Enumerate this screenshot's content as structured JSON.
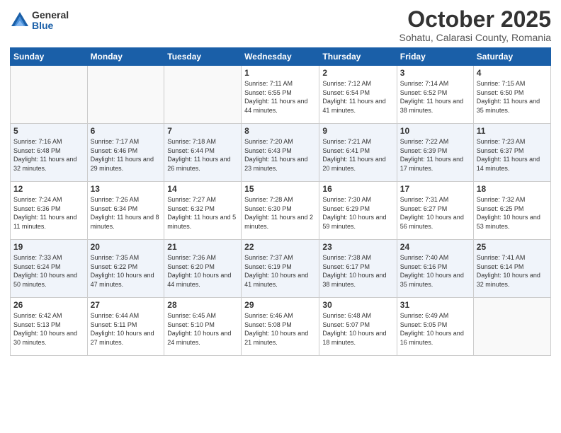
{
  "header": {
    "logo_general": "General",
    "logo_blue": "Blue",
    "month": "October 2025",
    "location": "Sohatu, Calarasi County, Romania"
  },
  "weekdays": [
    "Sunday",
    "Monday",
    "Tuesday",
    "Wednesday",
    "Thursday",
    "Friday",
    "Saturday"
  ],
  "weeks": [
    [
      {
        "day": "",
        "info": ""
      },
      {
        "day": "",
        "info": ""
      },
      {
        "day": "",
        "info": ""
      },
      {
        "day": "1",
        "info": "Sunrise: 7:11 AM\nSunset: 6:55 PM\nDaylight: 11 hours and 44 minutes."
      },
      {
        "day": "2",
        "info": "Sunrise: 7:12 AM\nSunset: 6:54 PM\nDaylight: 11 hours and 41 minutes."
      },
      {
        "day": "3",
        "info": "Sunrise: 7:14 AM\nSunset: 6:52 PM\nDaylight: 11 hours and 38 minutes."
      },
      {
        "day": "4",
        "info": "Sunrise: 7:15 AM\nSunset: 6:50 PM\nDaylight: 11 hours and 35 minutes."
      }
    ],
    [
      {
        "day": "5",
        "info": "Sunrise: 7:16 AM\nSunset: 6:48 PM\nDaylight: 11 hours and 32 minutes."
      },
      {
        "day": "6",
        "info": "Sunrise: 7:17 AM\nSunset: 6:46 PM\nDaylight: 11 hours and 29 minutes."
      },
      {
        "day": "7",
        "info": "Sunrise: 7:18 AM\nSunset: 6:44 PM\nDaylight: 11 hours and 26 minutes."
      },
      {
        "day": "8",
        "info": "Sunrise: 7:20 AM\nSunset: 6:43 PM\nDaylight: 11 hours and 23 minutes."
      },
      {
        "day": "9",
        "info": "Sunrise: 7:21 AM\nSunset: 6:41 PM\nDaylight: 11 hours and 20 minutes."
      },
      {
        "day": "10",
        "info": "Sunrise: 7:22 AM\nSunset: 6:39 PM\nDaylight: 11 hours and 17 minutes."
      },
      {
        "day": "11",
        "info": "Sunrise: 7:23 AM\nSunset: 6:37 PM\nDaylight: 11 hours and 14 minutes."
      }
    ],
    [
      {
        "day": "12",
        "info": "Sunrise: 7:24 AM\nSunset: 6:36 PM\nDaylight: 11 hours and 11 minutes."
      },
      {
        "day": "13",
        "info": "Sunrise: 7:26 AM\nSunset: 6:34 PM\nDaylight: 11 hours and 8 minutes."
      },
      {
        "day": "14",
        "info": "Sunrise: 7:27 AM\nSunset: 6:32 PM\nDaylight: 11 hours and 5 minutes."
      },
      {
        "day": "15",
        "info": "Sunrise: 7:28 AM\nSunset: 6:30 PM\nDaylight: 11 hours and 2 minutes."
      },
      {
        "day": "16",
        "info": "Sunrise: 7:30 AM\nSunset: 6:29 PM\nDaylight: 10 hours and 59 minutes."
      },
      {
        "day": "17",
        "info": "Sunrise: 7:31 AM\nSunset: 6:27 PM\nDaylight: 10 hours and 56 minutes."
      },
      {
        "day": "18",
        "info": "Sunrise: 7:32 AM\nSunset: 6:25 PM\nDaylight: 10 hours and 53 minutes."
      }
    ],
    [
      {
        "day": "19",
        "info": "Sunrise: 7:33 AM\nSunset: 6:24 PM\nDaylight: 10 hours and 50 minutes."
      },
      {
        "day": "20",
        "info": "Sunrise: 7:35 AM\nSunset: 6:22 PM\nDaylight: 10 hours and 47 minutes."
      },
      {
        "day": "21",
        "info": "Sunrise: 7:36 AM\nSunset: 6:20 PM\nDaylight: 10 hours and 44 minutes."
      },
      {
        "day": "22",
        "info": "Sunrise: 7:37 AM\nSunset: 6:19 PM\nDaylight: 10 hours and 41 minutes."
      },
      {
        "day": "23",
        "info": "Sunrise: 7:38 AM\nSunset: 6:17 PM\nDaylight: 10 hours and 38 minutes."
      },
      {
        "day": "24",
        "info": "Sunrise: 7:40 AM\nSunset: 6:16 PM\nDaylight: 10 hours and 35 minutes."
      },
      {
        "day": "25",
        "info": "Sunrise: 7:41 AM\nSunset: 6:14 PM\nDaylight: 10 hours and 32 minutes."
      }
    ],
    [
      {
        "day": "26",
        "info": "Sunrise: 6:42 AM\nSunset: 5:13 PM\nDaylight: 10 hours and 30 minutes."
      },
      {
        "day": "27",
        "info": "Sunrise: 6:44 AM\nSunset: 5:11 PM\nDaylight: 10 hours and 27 minutes."
      },
      {
        "day": "28",
        "info": "Sunrise: 6:45 AM\nSunset: 5:10 PM\nDaylight: 10 hours and 24 minutes."
      },
      {
        "day": "29",
        "info": "Sunrise: 6:46 AM\nSunset: 5:08 PM\nDaylight: 10 hours and 21 minutes."
      },
      {
        "day": "30",
        "info": "Sunrise: 6:48 AM\nSunset: 5:07 PM\nDaylight: 10 hours and 18 minutes."
      },
      {
        "day": "31",
        "info": "Sunrise: 6:49 AM\nSunset: 5:05 PM\nDaylight: 10 hours and 16 minutes."
      },
      {
        "day": "",
        "info": ""
      }
    ]
  ]
}
